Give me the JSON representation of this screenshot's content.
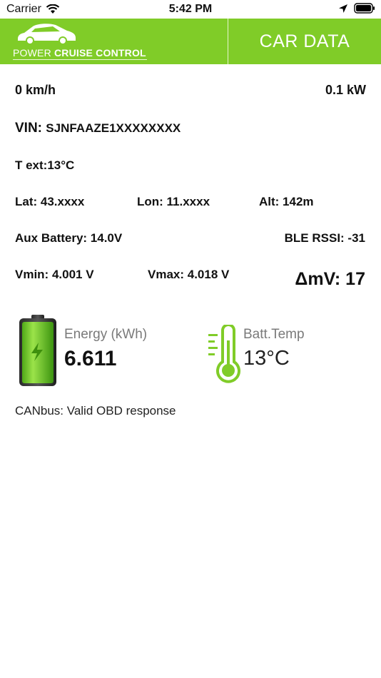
{
  "status_bar": {
    "carrier": "Carrier",
    "time": "5:42 PM"
  },
  "header": {
    "logo_text_light": "POWER ",
    "logo_text_bold": "CRUISE CONTROL",
    "title": "CAR DATA",
    "background_color": "#80cc28"
  },
  "readings": {
    "speed": "0 km/h",
    "power": "0.1 kW",
    "vin_label": "VIN: ",
    "vin_value": "SJNFAAZE1XXXXXXXX",
    "text_ext": "T ext:13°C",
    "lat": "Lat: 43.xxxx",
    "lon": "Lon: 11.xxxx",
    "alt": "Alt: 142m",
    "aux_battery": "Aux Battery: 14.0V",
    "ble_rssi": "BLE RSSI: -31",
    "vmin": "Vmin: 4.001 V",
    "vmax": "Vmax: 4.018 V",
    "delta_mv": "ΔmV: 17"
  },
  "energy": {
    "label": "Energy (kWh)",
    "value": "6.611",
    "icon": "battery-charging-icon"
  },
  "battery_temp": {
    "label": "Batt.Temp",
    "value": "13°C",
    "icon": "thermometer-icon"
  },
  "canbus_status": "CANbus: Valid OBD response"
}
